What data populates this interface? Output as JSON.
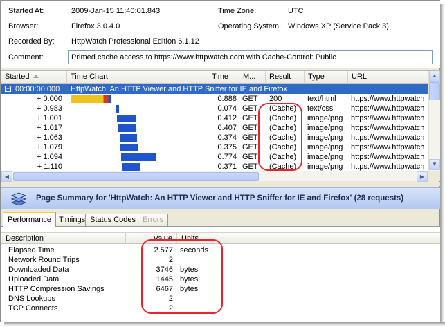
{
  "info": {
    "started_label": "Started At:",
    "started_value": "2009-Jan-15 11:40:01.843",
    "timezone_label": "Time Zone:",
    "timezone_value": "UTC",
    "browser_label": "Browser:",
    "browser_value": "Firefox 3.0.4.0",
    "os_label": "Operating System:",
    "os_value": "Windows XP (Service Pack 3)",
    "recorded_label": "Recorded By:",
    "recorded_value": "HttpWatch Professional Edition 6.1.12",
    "comment_label": "Comment:",
    "comment_value": "Primed cache access to https://www.httpwatch.com with Cache-Control: Public"
  },
  "grid": {
    "columns": [
      "Started",
      "Time Chart",
      "Time",
      "M...",
      "Result",
      "Type",
      "URL"
    ],
    "page_row": {
      "started": "00:00:00.000",
      "title": "HttpWatch: An HTTP Viewer and HTTP Sniffer for IE and Firefox",
      "expand_icon": "minus-box-icon"
    },
    "rows": [
      {
        "started": "+ 0.000",
        "time": "0.888",
        "method": "GET",
        "result": "200",
        "type": "text/html",
        "url": "https://www.httpwatch"
      },
      {
        "started": "+ 0.983",
        "time": "0.074",
        "method": "GET",
        "result": "(Cache)",
        "type": "text/css",
        "url": "https://www.httpwatch"
      },
      {
        "started": "+ 1.001",
        "time": "0.412",
        "method": "GET",
        "result": "(Cache)",
        "type": "image/png",
        "url": "https://www.httpwatch"
      },
      {
        "started": "+ 1.017",
        "time": "0.407",
        "method": "GET",
        "result": "(Cache)",
        "type": "image/png",
        "url": "https://www.httpwatch"
      },
      {
        "started": "+ 1.063",
        "time": "0.374",
        "method": "GET",
        "result": "(Cache)",
        "type": "image/png",
        "url": "https://www.httpwatch"
      },
      {
        "started": "+ 1.079",
        "time": "0.375",
        "method": "GET",
        "result": "(Cache)",
        "type": "image/png",
        "url": "https://www.httpwatch"
      },
      {
        "started": "+ 1.094",
        "time": "0.774",
        "method": "GET",
        "result": "(Cache)",
        "type": "image/png",
        "url": "https://www.httpwatch"
      },
      {
        "started": "+ 1.110",
        "time": "0.371",
        "method": "GET",
        "result": "(Cache)",
        "type": "image/png",
        "url": "https://www.httpwatch"
      }
    ]
  },
  "summary": {
    "title": "Page Summary for 'HttpWatch: An HTTP Viewer and HTTP Sniffer for IE and Firefox' (28 requests)",
    "icon": "layers-icon",
    "tabs": [
      "Performance",
      "Timings",
      "Status Codes",
      "Errors"
    ],
    "active_tab": "Performance",
    "columns": [
      "Description",
      "Value",
      "Units"
    ],
    "metrics": [
      {
        "description": "Elapsed Time",
        "value": "2.577",
        "units": "seconds"
      },
      {
        "description": "Network Round Trips",
        "value": "2",
        "units": ""
      },
      {
        "description": "Downloaded Data",
        "value": "3746",
        "units": "bytes"
      },
      {
        "description": "Uploaded Data",
        "value": "1445",
        "units": "bytes"
      },
      {
        "description": "HTTP Compression Savings",
        "value": "6467",
        "units": "bytes"
      },
      {
        "description": "DNS Lookups",
        "value": "2",
        "units": ""
      },
      {
        "description": "TCP Connects",
        "value": "2",
        "units": ""
      }
    ]
  },
  "colors": {
    "selection": "#316ac5",
    "bar_blue": "#1f55cc",
    "bar_yellow": "#f0c21c",
    "bar_red": "#d23b1e",
    "annotation_red": "#e8232b"
  }
}
